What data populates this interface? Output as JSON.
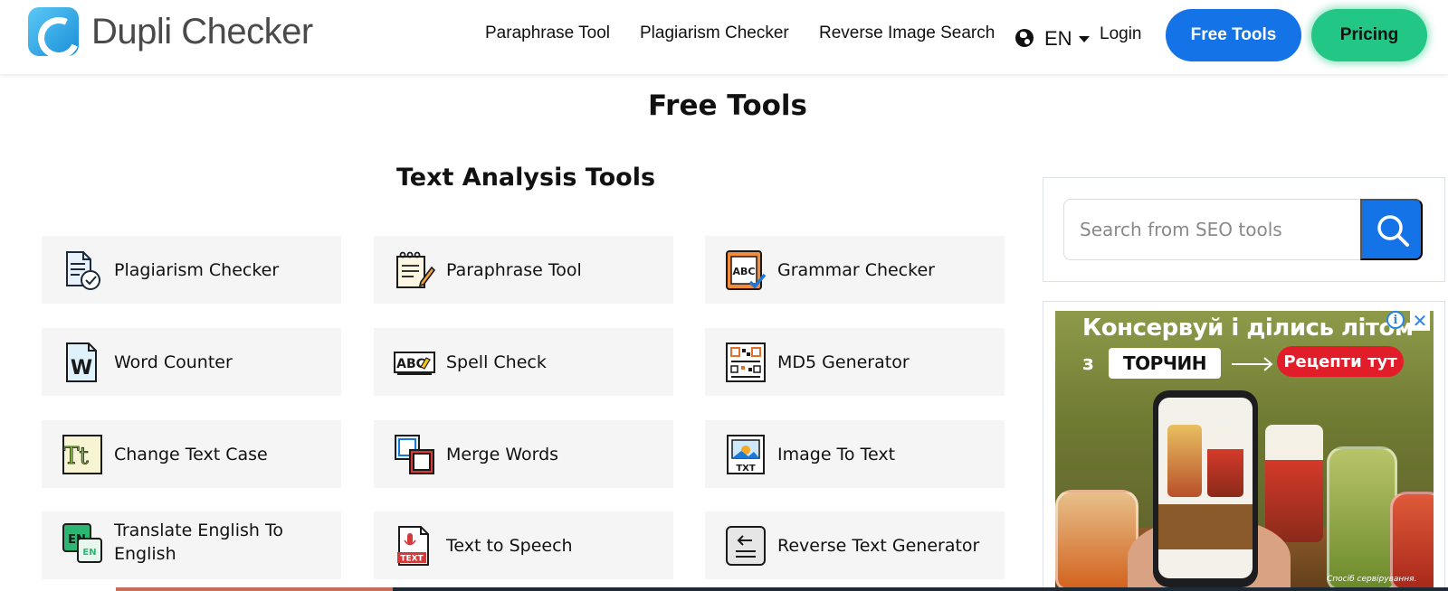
{
  "header": {
    "logo_text": "Dupli Checker",
    "nav": [
      "Paraphrase Tool",
      "Plagiarism Checker",
      "Reverse Image Search"
    ],
    "language": "EN",
    "login": "Login",
    "free_tools_button": "Free Tools",
    "pricing_button": "Pricing"
  },
  "page_title": "Free Tools",
  "section_title": "Text Analysis Tools",
  "tools": [
    {
      "label": "Plagiarism Checker",
      "icon": "plagiarism-checker-icon"
    },
    {
      "label": "Paraphrase Tool",
      "icon": "paraphrase-tool-icon"
    },
    {
      "label": "Grammar Checker",
      "icon": "grammar-checker-icon"
    },
    {
      "label": "Word Counter",
      "icon": "word-counter-icon"
    },
    {
      "label": "Spell Check",
      "icon": "spell-check-icon"
    },
    {
      "label": "MD5 Generator",
      "icon": "md5-generator-icon"
    },
    {
      "label": "Change Text Case",
      "icon": "change-text-case-icon"
    },
    {
      "label": "Merge Words",
      "icon": "merge-words-icon"
    },
    {
      "label": "Image To Text",
      "icon": "image-to-text-icon"
    },
    {
      "label": "Translate English To English",
      "icon": "translate-icon"
    },
    {
      "label": "Text to Speech",
      "icon": "text-to-speech-icon"
    },
    {
      "label": "Reverse Text Generator",
      "icon": "reverse-text-icon"
    }
  ],
  "icon_text": {
    "grammar": "ABC",
    "word": "W",
    "spell": "ABC",
    "case": "Tt",
    "image_to_text": "TXT",
    "translate_en": "EN",
    "translate_en2": "EN",
    "tts": "TEXT"
  },
  "search": {
    "placeholder": "Search from SEO tools"
  },
  "ad": {
    "headline": "Консервуй і ділись літом",
    "z": "з",
    "brand": "ТОРЧИН",
    "cta": "Рецепти тут",
    "info": "i",
    "close": "✕",
    "note": "Спосіб сервірування."
  },
  "colors": {
    "primary_blue": "#1473e6",
    "pricing_green": "#22c786",
    "tool_bg": "#f5f5f5"
  }
}
